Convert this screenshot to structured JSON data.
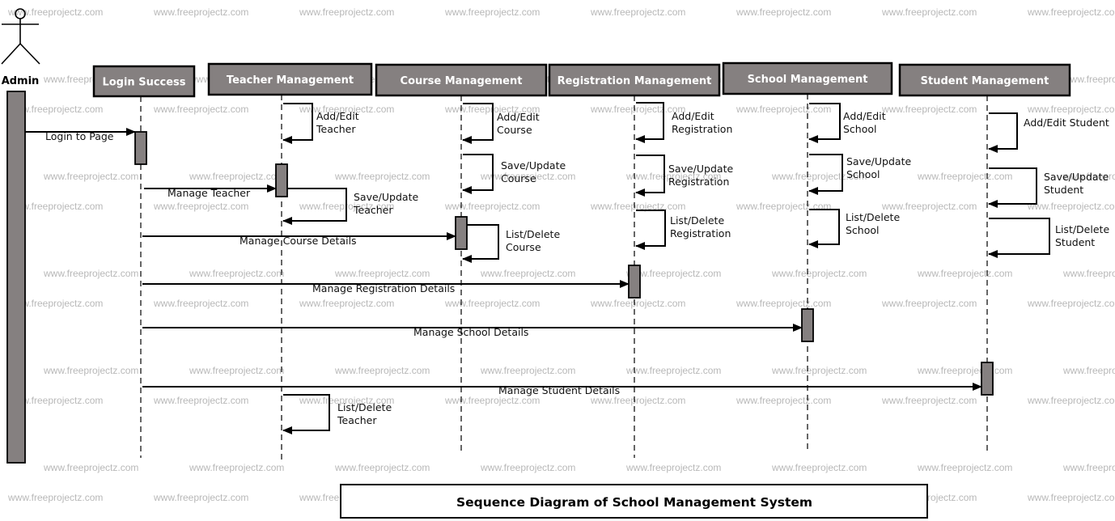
{
  "watermark": "www.freeprojectz.com",
  "actor": {
    "name": "Admin"
  },
  "lifelines": [
    {
      "id": "login",
      "label": "Login Success"
    },
    {
      "id": "teacher",
      "label": "Teacher Management"
    },
    {
      "id": "course",
      "label": "Course Management"
    },
    {
      "id": "registration",
      "label": "Registration Management"
    },
    {
      "id": "school",
      "label": "School Management"
    },
    {
      "id": "student",
      "label": "Student Management"
    }
  ],
  "messages": [
    {
      "from": "admin",
      "to": "login",
      "label": "Login to Page"
    },
    {
      "from": "login",
      "to": "teacher",
      "label": "Manage Teacher"
    },
    {
      "from": "login",
      "to": "course",
      "label": "Manage Course Details"
    },
    {
      "from": "login",
      "to": "registration",
      "label": "Manage Registration Details"
    },
    {
      "from": "login",
      "to": "school",
      "label": "Manage School Details"
    },
    {
      "from": "login",
      "to": "student",
      "label": "Manage Student Details"
    }
  ],
  "self_messages": [
    {
      "lifeline": "teacher",
      "label": [
        "Add/Edit",
        "Teacher"
      ]
    },
    {
      "lifeline": "teacher",
      "label": [
        "Save/Update",
        "Teacher"
      ]
    },
    {
      "lifeline": "teacher",
      "label": [
        "List/Delete",
        "Teacher"
      ]
    },
    {
      "lifeline": "course",
      "label": [
        "Add/Edit",
        "Course"
      ]
    },
    {
      "lifeline": "course",
      "label": [
        "Save/Update",
        "Course"
      ]
    },
    {
      "lifeline": "course",
      "label": [
        "List/Delete",
        "Course"
      ]
    },
    {
      "lifeline": "registration",
      "label": [
        "Add/Edit",
        "Registration"
      ]
    },
    {
      "lifeline": "registration",
      "label": [
        "Save/Update",
        "Registration"
      ]
    },
    {
      "lifeline": "registration",
      "label": [
        "List/Delete",
        "Registration"
      ]
    },
    {
      "lifeline": "school",
      "label": [
        "Add/Edit",
        "School"
      ]
    },
    {
      "lifeline": "school",
      "label": [
        "Save/Update",
        "School"
      ]
    },
    {
      "lifeline": "school",
      "label": [
        "List/Delete",
        "School"
      ]
    },
    {
      "lifeline": "student",
      "label": [
        "Add/Edit Student"
      ]
    },
    {
      "lifeline": "student",
      "label": [
        "Save/Update",
        "Student"
      ]
    },
    {
      "lifeline": "student",
      "label": [
        "List/Delete",
        "Student"
      ]
    }
  ],
  "title": "Sequence Diagram of School Management System"
}
